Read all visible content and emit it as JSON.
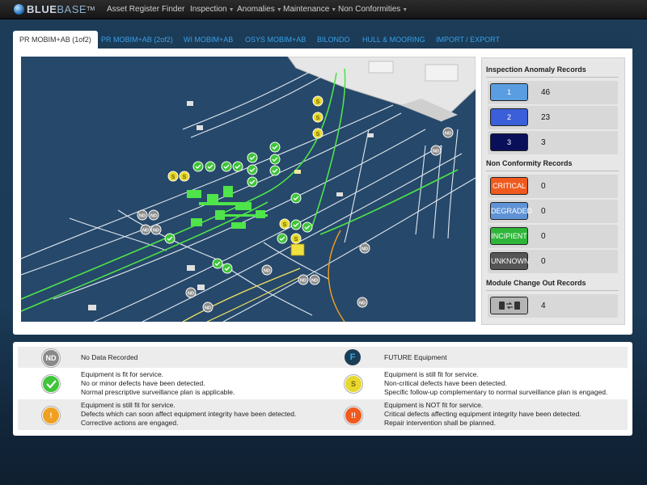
{
  "brand": {
    "prefix": "BLUE",
    "suffix": "BASE",
    "tm": "TM"
  },
  "nav": {
    "asset_register": "Asset Register",
    "finder": "Finder",
    "inspection": "Inspection",
    "anomalies": "Anomalies",
    "maintenance": "Maintenance",
    "non_conformities": "Non Conformities"
  },
  "tabs": [
    {
      "label": "PR MOBIM+AB (1of2)",
      "active": true
    },
    {
      "label": "PR MOBIM+AB (2of2)"
    },
    {
      "label": "WI MOBIM+AB"
    },
    {
      "label": "OSYS MOBIM+AB"
    },
    {
      "label": "BILONDO"
    },
    {
      "label": "HULL & MOORING"
    },
    {
      "label": "IMPORT / EXPORT"
    }
  ],
  "summary": {
    "inspection_title": "Inspection Anomaly Records",
    "inspection": [
      {
        "label": "1",
        "value": "46",
        "color": "#5a9de0"
      },
      {
        "label": "2",
        "value": "23",
        "color": "#3a5fd8"
      },
      {
        "label": "3",
        "value": "3",
        "color": "#0a0f5a"
      }
    ],
    "nc_title": "Non Conformity Records",
    "nc": [
      {
        "label": "CRITICAL",
        "value": "0",
        "color": "#f05a1e"
      },
      {
        "label": "DEGRADED",
        "value": "0",
        "color": "#5f93d6"
      },
      {
        "label": "INCIPIENT",
        "value": "0",
        "color": "#2fb63a"
      },
      {
        "label": "UNKNOWN",
        "value": "0",
        "color": "#555555"
      }
    ],
    "module_title": "Module Change Out Records",
    "module": {
      "value": "4"
    }
  },
  "legend": {
    "nd": {
      "icon": "ND",
      "text": "No Data Recorded"
    },
    "future": {
      "icon": "F",
      "text": "FUTURE Equipment"
    },
    "ok": {
      "line1": "Equipment is fit for service.",
      "line2": "No or minor defects have been detected.",
      "line3": "Normal prescriptive surveillance plan is applicable."
    },
    "s": {
      "icon": "S",
      "line1": "Equipment is still fit for service.",
      "line2": "Non-critical defects have been detected.",
      "line3": "Specific follow-up complementary to normal surveillance plan is engaged."
    },
    "warn": {
      "icon": "!",
      "line1": "Equipment is still fit for service.",
      "line2": "Defects which can soon affect equipment integrity have been detected.",
      "line3": "Corrective actions are engaged."
    },
    "crit": {
      "icon": "!!",
      "line1": "Equipment is NOT fit for service.",
      "line2": "Critical defects affecting equipment integrity have been detected.",
      "line3": "Repair intervention shall be planned."
    }
  },
  "map_markers": {
    "nd_label": "ND",
    "s_label": "S"
  }
}
